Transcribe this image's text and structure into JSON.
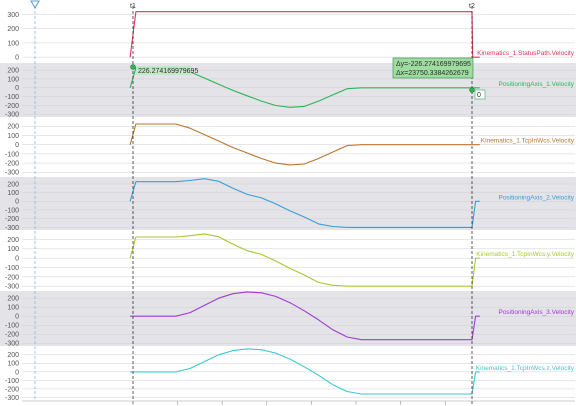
{
  "chart_data": {
    "type": "line",
    "cursors": {
      "t1": {
        "label": "t1",
        "x": 0.0
      },
      "t2": {
        "label": "t2",
        "x": 23750.3384262679
      }
    },
    "x_range": [
      -500,
      24300
    ],
    "t1_readout": "226.274169979695",
    "t2_readout": "0",
    "measurement": {
      "delta_y": "Δy=-226.274169979695",
      "delta_x": "Δx=23750.3384262679"
    },
    "colors": {
      "band": "#e3e3e8",
      "cursor": "#333333",
      "t0_marker": "#88bcd6",
      "measure_box": "#9fdca0"
    },
    "series": [
      {
        "name": "Kinematics_1.StatusPath.Velocity",
        "color": "#e0305a",
        "ylim": [
          -20,
          360
        ],
        "ticks": [
          0,
          100,
          200,
          300
        ],
        "shaded": false,
        "x": [
          -200,
          200,
          23000,
          23750,
          23800,
          24300
        ],
        "values": [
          0,
          320,
          320,
          320,
          0,
          0
        ]
      },
      {
        "name": "PositioningAxis_1.Velocity",
        "color": "#2cb455",
        "ylim": [
          -330,
          280
        ],
        "ticks": [
          -300,
          -200,
          -100,
          0,
          100,
          200
        ],
        "shaded": true,
        "x": [
          -200,
          200,
          1000,
          2000,
          3000,
          4000,
          5000,
          6000,
          7000,
          8000,
          9000,
          10000,
          11000,
          12000,
          13000,
          14000,
          15000,
          16000,
          23000,
          23750,
          24000,
          24300
        ],
        "values": [
          0,
          226,
          226,
          226,
          226,
          180,
          110,
          40,
          -30,
          -90,
          -150,
          -200,
          -220,
          -210,
          -150,
          -80,
          -10,
          0,
          0,
          0,
          0,
          0
        ]
      },
      {
        "name": "Kinematics_1.TcpInWcs.Velocity",
        "color": "#b87630",
        "ylim": [
          -330,
          280
        ],
        "ticks": [
          -300,
          -200,
          -100,
          0,
          100,
          200
        ],
        "shaded": false,
        "x": [
          -200,
          200,
          1000,
          2000,
          3000,
          4000,
          5000,
          6000,
          7000,
          8000,
          9000,
          10000,
          11000,
          12000,
          13000,
          14000,
          15000,
          16000,
          23000,
          23750,
          24300
        ],
        "values": [
          0,
          226,
          226,
          226,
          226,
          180,
          110,
          40,
          -30,
          -90,
          -150,
          -200,
          -220,
          -210,
          -150,
          -80,
          -10,
          0,
          0,
          0,
          0
        ]
      },
      {
        "name": "PositioningAxis_2.Velocity",
        "color": "#3a9ed6",
        "ylim": [
          -330,
          280
        ],
        "ticks": [
          -300,
          -200,
          -100,
          0,
          100,
          200
        ],
        "shaded": true,
        "x": [
          -200,
          200,
          1000,
          2000,
          3000,
          4000,
          5000,
          6000,
          7000,
          8000,
          9000,
          10000,
          11000,
          12000,
          13000,
          14000,
          15000,
          16000,
          23000,
          23750,
          24000,
          24300
        ],
        "values": [
          0,
          226,
          226,
          226,
          226,
          240,
          260,
          230,
          150,
          80,
          40,
          -30,
          -110,
          -180,
          -260,
          -290,
          -300,
          -300,
          -300,
          -300,
          0,
          0
        ]
      },
      {
        "name": "Kinematics_1.TcpInWcs.y.Velocity",
        "color": "#a8c832",
        "ylim": [
          -330,
          280
        ],
        "ticks": [
          -300,
          -200,
          -100,
          0,
          100,
          200
        ],
        "shaded": false,
        "x": [
          -200,
          200,
          1000,
          2000,
          3000,
          4000,
          5000,
          6000,
          7000,
          8000,
          9000,
          10000,
          11000,
          12000,
          13000,
          14000,
          15000,
          16000,
          23000,
          23750,
          24000,
          24300
        ],
        "values": [
          0,
          226,
          226,
          226,
          226,
          240,
          260,
          230,
          150,
          80,
          40,
          -30,
          -110,
          -180,
          -260,
          -290,
          -300,
          -300,
          -300,
          -300,
          0,
          0
        ]
      },
      {
        "name": "PositioningAxis_3.Velocity",
        "color": "#a03ad0",
        "ylim": [
          -330,
          280
        ],
        "ticks": [
          -300,
          -200,
          -100,
          0,
          100,
          200
        ],
        "shaded": true,
        "x": [
          -200,
          200,
          1000,
          2000,
          3000,
          4000,
          5000,
          6000,
          7000,
          8000,
          9000,
          10000,
          11000,
          12000,
          13000,
          14000,
          15000,
          16000,
          23000,
          23750,
          24000,
          24300
        ],
        "values": [
          0,
          0,
          0,
          0,
          0,
          40,
          120,
          200,
          250,
          270,
          260,
          220,
          150,
          60,
          -40,
          -150,
          -230,
          -260,
          -260,
          -260,
          0,
          0
        ]
      },
      {
        "name": "Kinematics_1.TcpInWcs.z.Velocity",
        "color": "#3cc8d0",
        "ylim": [
          -330,
          280
        ],
        "ticks": [
          -300,
          -200,
          -100,
          0,
          100,
          200
        ],
        "shaded": false,
        "x": [
          -200,
          200,
          1000,
          2000,
          3000,
          4000,
          5000,
          6000,
          7000,
          8000,
          9000,
          10000,
          11000,
          12000,
          13000,
          14000,
          15000,
          16000,
          23000,
          23750,
          24000,
          24300
        ],
        "values": [
          0,
          0,
          0,
          0,
          0,
          40,
          120,
          200,
          250,
          270,
          260,
          220,
          150,
          60,
          -40,
          -150,
          -230,
          -260,
          -260,
          -260,
          0,
          0
        ]
      }
    ]
  }
}
